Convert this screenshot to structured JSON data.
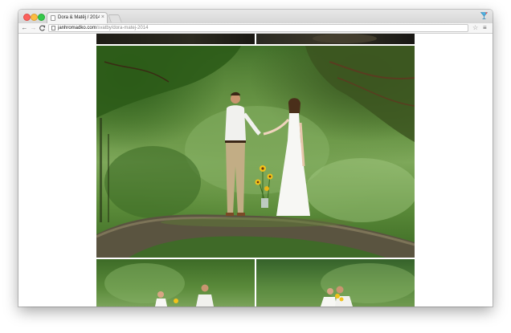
{
  "browser": {
    "tab": {
      "title": "Dora & Matěj / 2014 - Sv",
      "close_glyph": "×"
    },
    "toolbar": {
      "back_glyph": "←",
      "forward_glyph": "→",
      "reload_glyph": "C",
      "url_host": "janhromadko.com",
      "url_path": "/svatby/dora-matej-2014",
      "bookmark_glyph": "☆",
      "menu_glyph": "≡"
    },
    "icons": {
      "favicon": "page-icon",
      "extension": "cocktail-glass-icon"
    }
  },
  "gallery": {
    "photos": [
      {
        "position": "top-left",
        "description_name": "photo-partial-dark"
      },
      {
        "position": "top-right",
        "description_name": "photo-partial-dark"
      },
      {
        "position": "main",
        "description_name": "couple-holding-hands-on-mossy-stone-bridge"
      },
      {
        "position": "bottom-left",
        "description_name": "couple-with-sunflowers"
      },
      {
        "position": "bottom-right",
        "description_name": "couple-embracing-with-sunflowers"
      }
    ]
  },
  "colors": {
    "close": "#fc605b",
    "minimize": "#fdbc40",
    "maximize": "#34c84a"
  }
}
